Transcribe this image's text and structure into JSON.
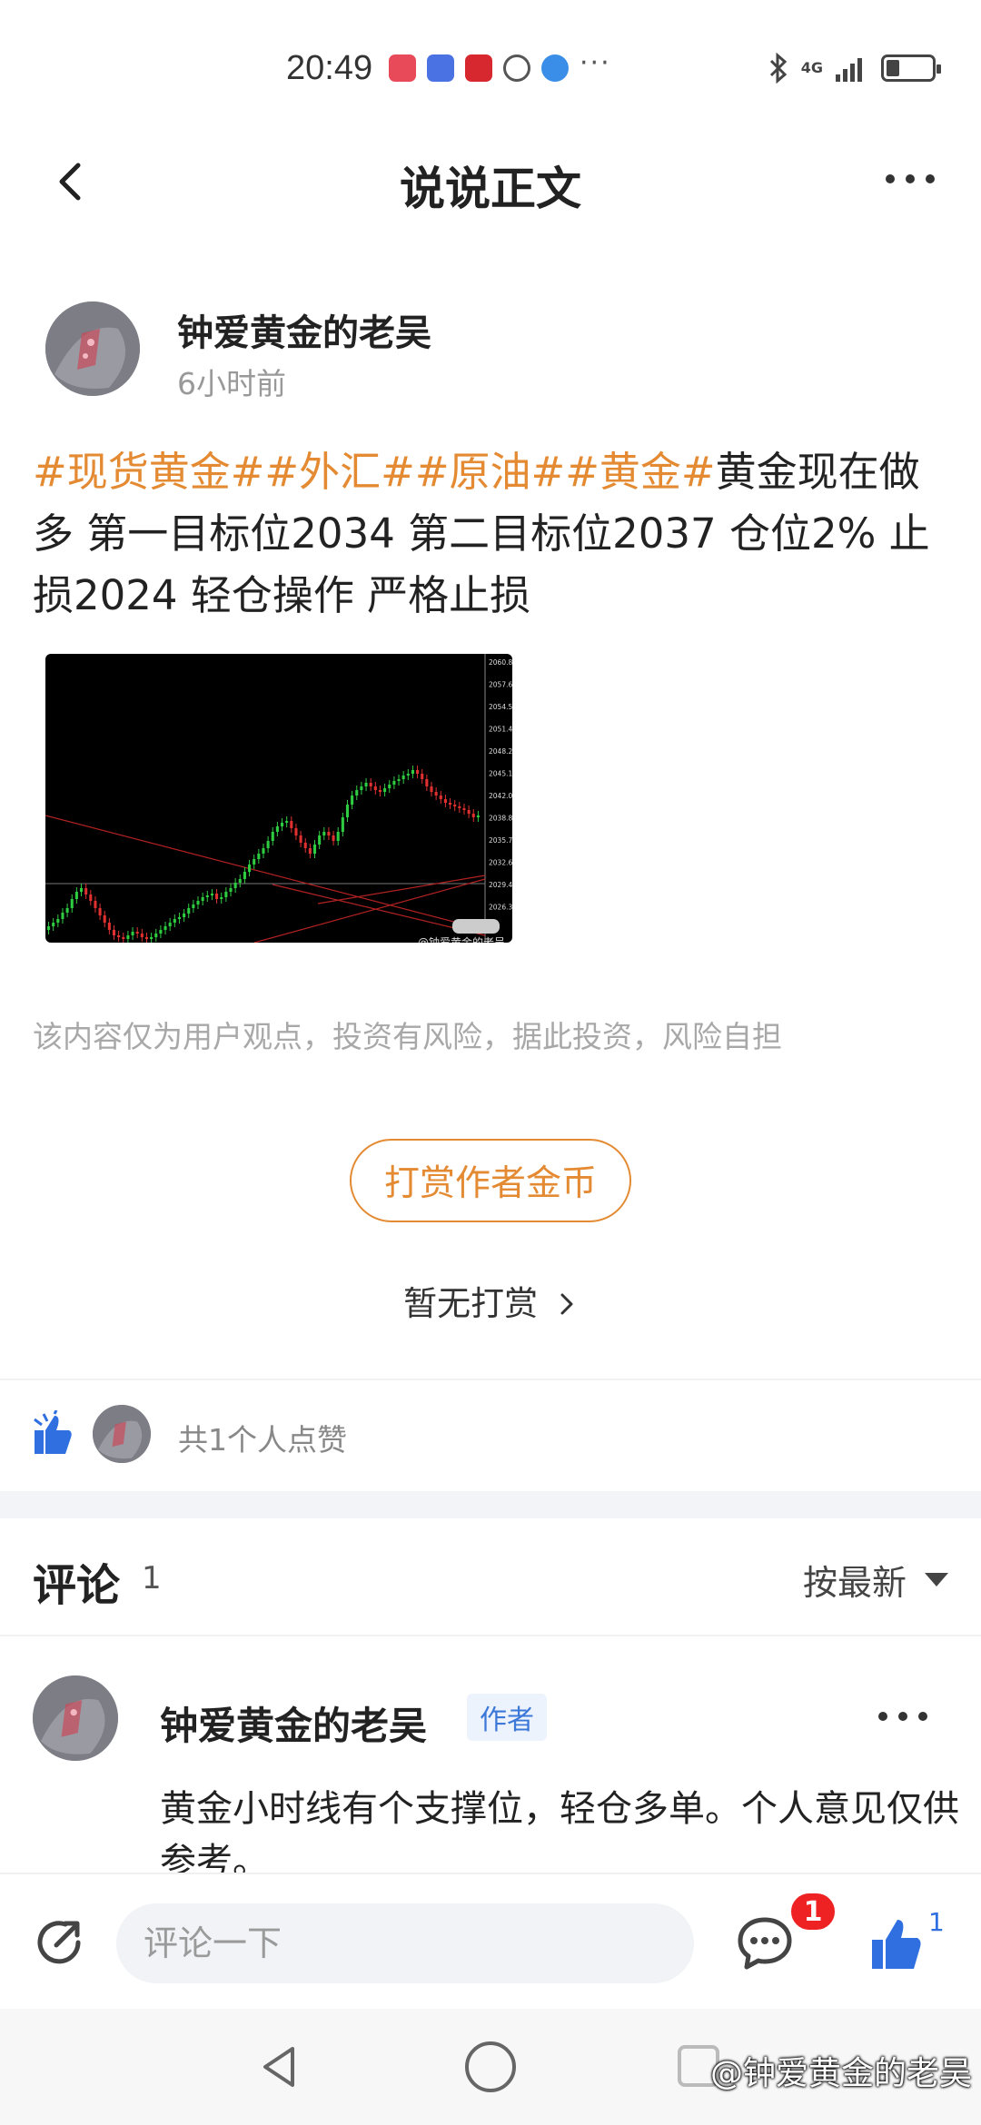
{
  "status_bar": {
    "time": "20:49",
    "dots": "···",
    "network": "4G"
  },
  "header": {
    "title": "说说正文"
  },
  "post": {
    "author_name": "钟爱黄金的老吴",
    "time_ago": "6小时前",
    "tags": "#现货黄金##外汇##原油##黄金#",
    "body": "黄金现在做多  第一目标位2034    第二目标位2037       仓位2%  止损2024    轻仓操作   严格止损",
    "image_labels": {
      "price_labels": [
        "2060.80",
        "2057.60",
        "2054.55",
        "2051.40",
        "2048.25",
        "2045.10",
        "2042.00",
        "2038.85",
        "2035.75",
        "2032.60",
        "2029.40",
        "2026.30"
      ],
      "watermark": "@钟爱黄金的老吴"
    },
    "disclaimer": "该内容仅为用户观点，投资有风险，据此投资，风险自担"
  },
  "reward": {
    "button_label": "打赏作者金币",
    "no_reward_label": "暂无打赏"
  },
  "likes": {
    "summary": "共1个人点赞"
  },
  "comments": {
    "title": "评论",
    "count": "1",
    "sort_label": "按最新",
    "items": [
      {
        "author": "钟爱黄金的老吴",
        "badge": "作者",
        "text": "黄金小时线有个支撑位，轻仓多单。个人意见仅供参考。"
      }
    ]
  },
  "bottom_bar": {
    "comment_placeholder": "评论一下",
    "comment_badge": "1",
    "like_count": "1"
  },
  "watermark": "@钟爱黄金的老吴",
  "colors": {
    "tag": "#e38a32",
    "accent_blue": "#2f6fe0",
    "badge_red": "#ee2222"
  }
}
